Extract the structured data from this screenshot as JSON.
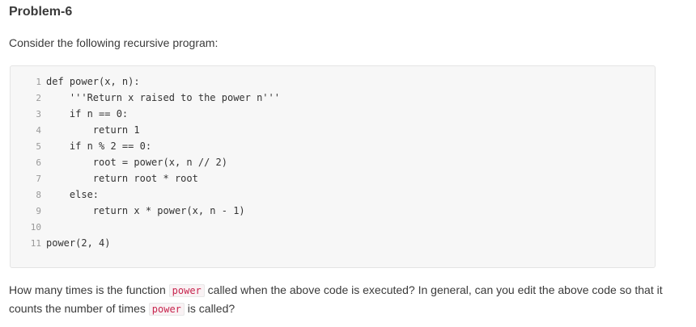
{
  "header": {
    "title": "Problem-6"
  },
  "intro": {
    "text": "Consider the following recursive program:"
  },
  "code": {
    "lines": [
      {
        "num": "1",
        "text": "def power(x, n):"
      },
      {
        "num": "2",
        "text": "    '''Return x raised to the power n'''"
      },
      {
        "num": "3",
        "text": "    if n == 0:"
      },
      {
        "num": "4",
        "text": "        return 1"
      },
      {
        "num": "5",
        "text": "    if n % 2 == 0:"
      },
      {
        "num": "6",
        "text": "        root = power(x, n // 2)"
      },
      {
        "num": "7",
        "text": "        return root * root"
      },
      {
        "num": "8",
        "text": "    else:"
      },
      {
        "num": "9",
        "text": "        return x * power(x, n - 1)"
      },
      {
        "num": "10",
        "text": ""
      },
      {
        "num": "11",
        "text": "power(2, 4)"
      }
    ]
  },
  "question": {
    "part1": "How many times is the function ",
    "code1": "power",
    "part2": " called when the above code is executed? In general, can you edit the above code so that it counts the number of times ",
    "code2": "power",
    "part3": " is called?"
  }
}
